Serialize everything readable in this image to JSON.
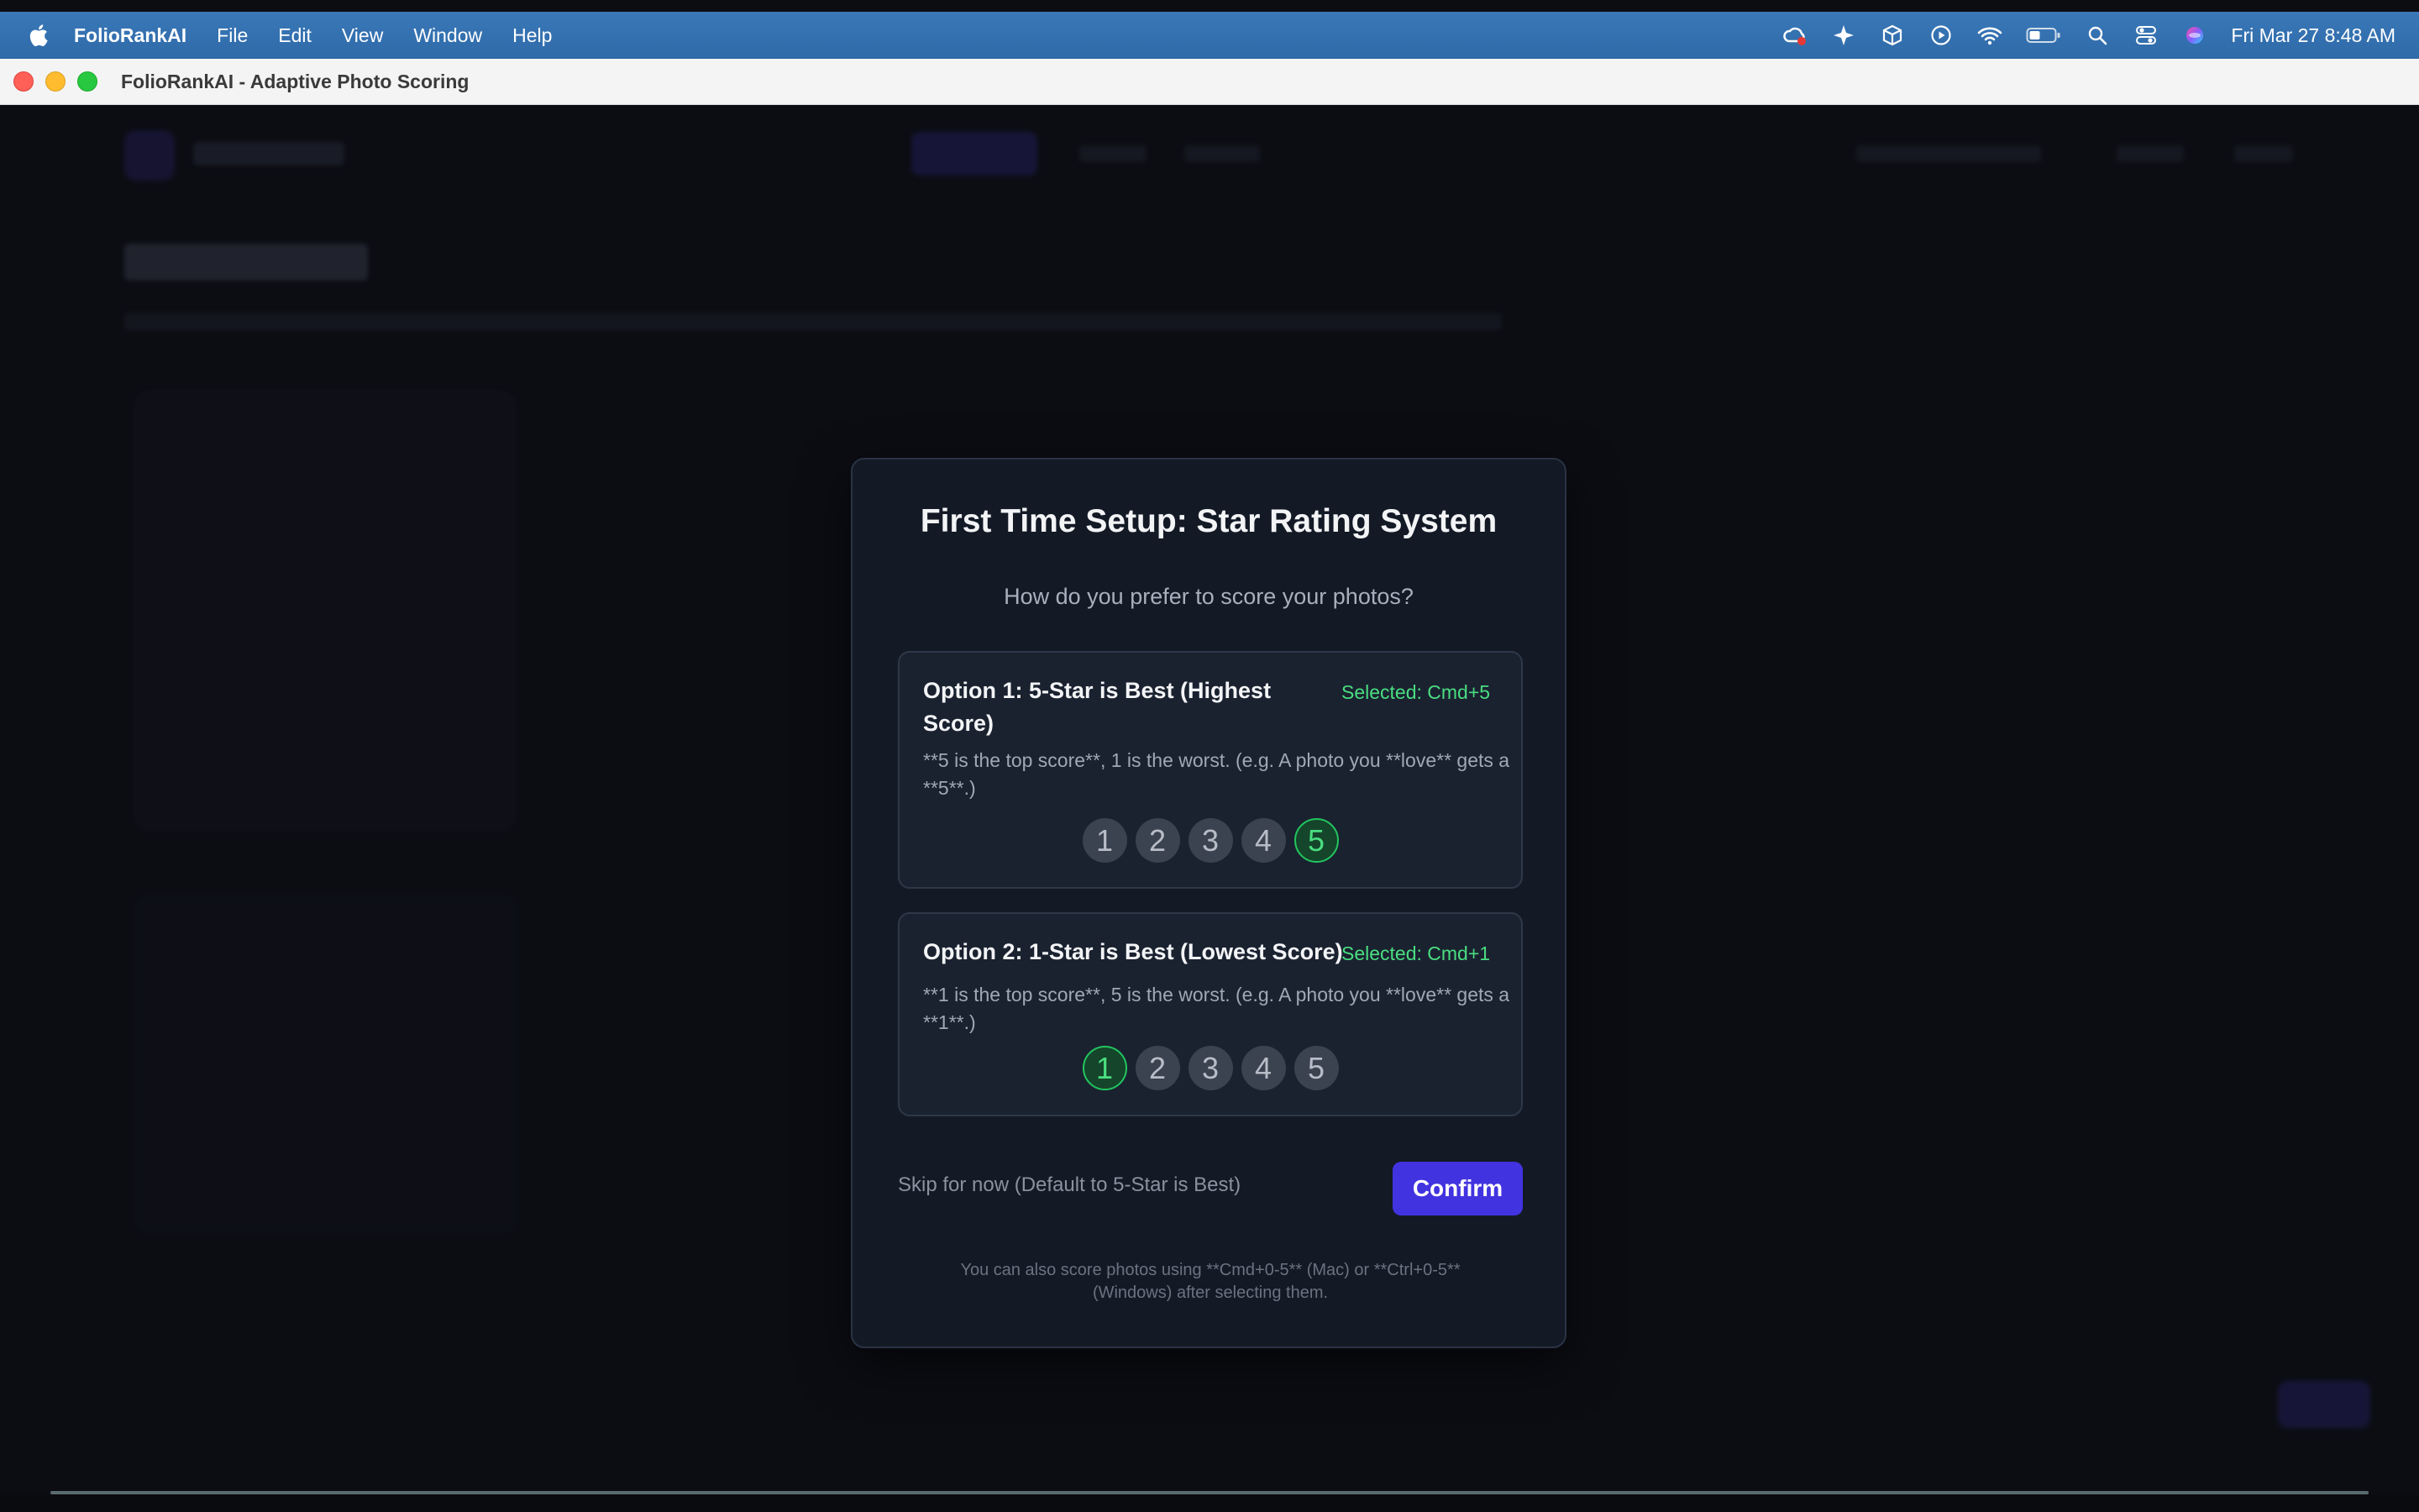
{
  "menubar": {
    "app_name": "FolioRankAI",
    "items": [
      "File",
      "Edit",
      "View",
      "Window",
      "Help"
    ],
    "clock": "Fri Mar 27  8:48 AM",
    "status_icons": [
      "creative-cloud-icon",
      "sparkle-icon",
      "box-icon",
      "play-circle-icon",
      "wifi-icon",
      "battery-icon",
      "search-icon",
      "control-center-icon",
      "siri-icon"
    ]
  },
  "window": {
    "title": "FolioRankAI - Adaptive Photo Scoring"
  },
  "modal": {
    "title": "First Time Setup: Star Rating System",
    "subtitle": "How do you prefer to score your photos?",
    "options": [
      {
        "title": "Option 1: 5-Star is Best (Highest Score)",
        "selected_label": "Selected: Cmd+5",
        "description": "**5 is the top score**, 1 is the worst. (e.g. A photo you **love** gets a **5**.)",
        "stars": [
          "1",
          "2",
          "3",
          "4",
          "5"
        ],
        "highlighted": "5"
      },
      {
        "title": "Option 2: 1-Star is Best (Lowest Score)",
        "selected_label": "Selected: Cmd+1",
        "description": "**1 is the top score**, 5 is the worst. (e.g. A photo you **love** gets a **1**.)",
        "stars": [
          "1",
          "2",
          "3",
          "4",
          "5"
        ],
        "highlighted": "1"
      }
    ],
    "skip_label": "Skip for now (Default to 5-Star is Best)",
    "confirm_label": "Confirm",
    "footnote": "You can also score photos using **Cmd+0-5** (Mac) or **Ctrl+0-5** (Windows) after selecting them."
  },
  "colors": {
    "accent": "#4233e0",
    "selected_green": "#4ade80",
    "menubar": "#3574b4"
  }
}
